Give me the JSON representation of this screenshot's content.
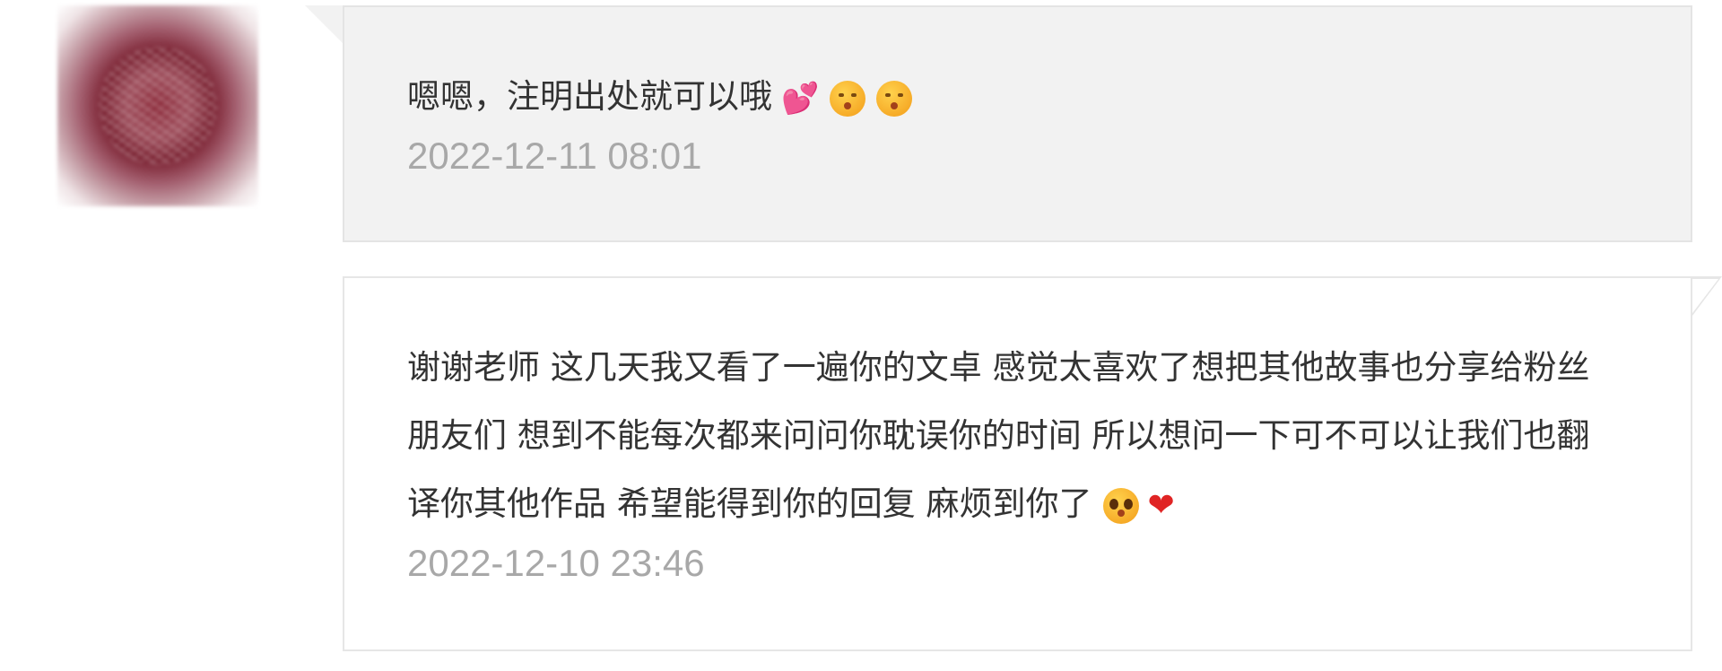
{
  "messages": [
    {
      "text": "嗯嗯，注明出处就可以哦",
      "emojis": [
        "two-hearts",
        "kissing-face",
        "kissing-face"
      ],
      "time": "2022-12-11 08:01"
    },
    {
      "text": "谢谢老师 这几天我又看了一遍你的文卓 感觉太喜欢了想把其他故事也分享给粉丝朋友们 想到不能每次都来问问你耽误你的时间 所以想问一下可不可以让我们也翻译你其他作品 希望能得到你的回复 麻烦到你了",
      "emojis": [
        "pleading-face",
        "red-heart"
      ],
      "time": "2022-12-10 23:46"
    }
  ],
  "colors": {
    "bubble_gray": "#f2f2f2",
    "text": "#333333",
    "timestamp": "#a8a8a8",
    "heart": "#e02424"
  }
}
